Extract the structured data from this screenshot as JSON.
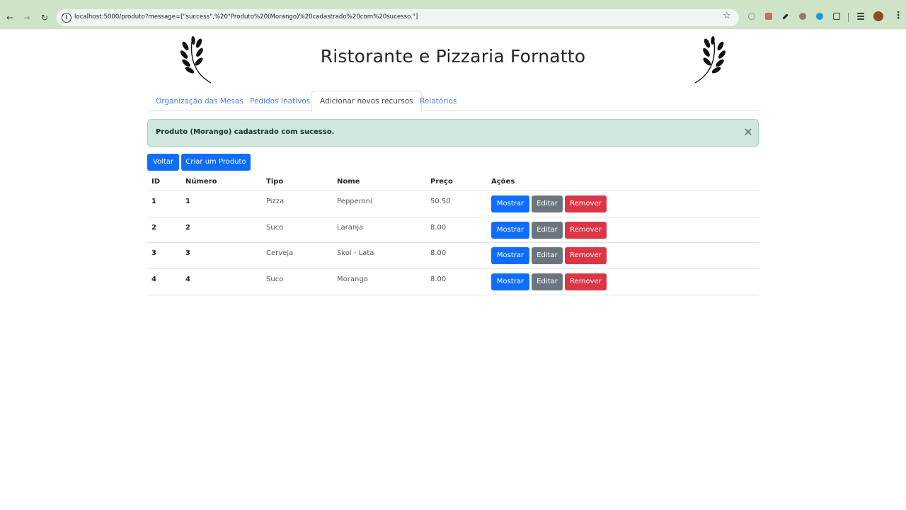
{
  "browser": {
    "url": "localhost:5000/produto?message=[\"success\",%20\"Produto%20(Morango)%20cadastrado%20com%20sucesso.\"]"
  },
  "header": {
    "title": "Ristorante e Pizzaria Fornatto"
  },
  "tabs": [
    {
      "label": "Organização das Mesas"
    },
    {
      "label": "Pedidos Inativos"
    },
    {
      "label": "Adicionar novos recursos"
    },
    {
      "label": "Relatórios"
    }
  ],
  "alert": {
    "message": "Produto (Morango) cadastrado com sucesso."
  },
  "toolbar": {
    "back_label": "Voltar",
    "create_label": "Criar um Produto"
  },
  "table": {
    "headers": [
      "ID",
      "Número",
      "Tipo",
      "Nome",
      "Preço",
      "Ações"
    ],
    "rows": [
      {
        "id": "1",
        "numero": "1",
        "tipo": "Pizza",
        "nome": "Pepperoni",
        "preco": "50.50"
      },
      {
        "id": "2",
        "numero": "2",
        "tipo": "Suco",
        "nome": "Laranja",
        "preco": "8.00"
      },
      {
        "id": "3",
        "numero": "3",
        "tipo": "Cerveja",
        "nome": "Skol - Lata",
        "preco": "8.00"
      },
      {
        "id": "4",
        "numero": "4",
        "tipo": "Suco",
        "nome": "Morango",
        "preco": "8.00"
      }
    ],
    "actions": {
      "show": "Mostrar",
      "edit": "Editar",
      "remove": "Remover"
    }
  },
  "colors": {
    "primary": "#0d6efd",
    "secondary": "#6c757d",
    "danger": "#dc3545",
    "alert_bg": "#d1e7dd",
    "browser_bar": "#cfe3c8"
  }
}
